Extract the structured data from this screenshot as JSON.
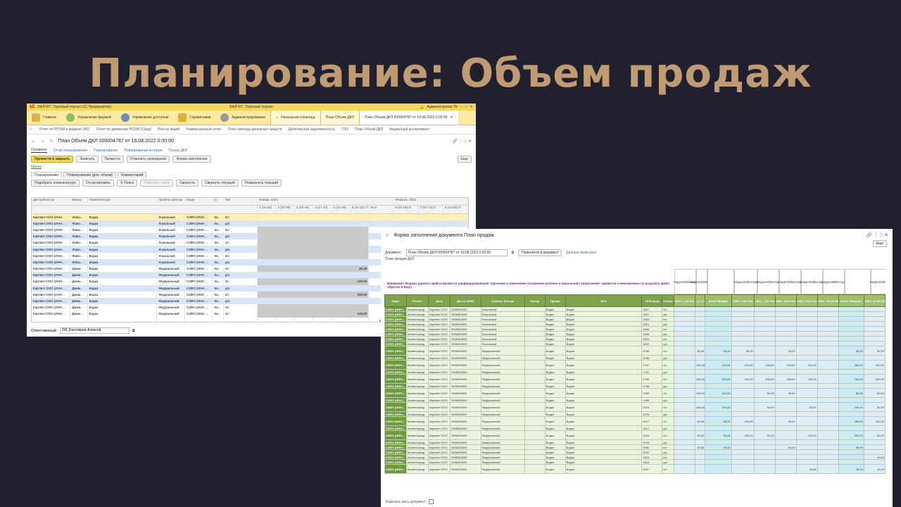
{
  "slide_title": "Планирование: Объем продаж",
  "win1": {
    "app_title": "БАЛЧУГ: Торговый портал",
    "app_subtitle": "БАЛЧУГ: Торговый портал (1С:Предприятие)",
    "user": "Администратор ТК",
    "sections": [
      "Главное",
      "Управление фирмой",
      "Управление доступом",
      "Справочники",
      "Администрирование"
    ],
    "open_tabs": [
      "Начальная страница",
      "План Объем ДКЛ",
      "План Объем ДКЛ 000004787 от 19.08.2022 0:00:00"
    ],
    "links": [
      "Отчет по POSM в разрезе SKU",
      "Отчет по движению POSM (Свод)",
      "Реестр акций",
      "Универсальный отчет",
      "План прихода денежных средств",
      "Дебиторская задолженность",
      "ТЗО",
      "План Объем ДКЛ",
      "Акционный ассортимент"
    ],
    "doc_title": "План Объем ДКЛ 000004787 от 19.08.2022 0:00:00",
    "doc_tabs": [
      "Основное",
      "Отчет планирования",
      "Планирование",
      "Планирование история",
      "Планы ДКЛ"
    ],
    "commands": {
      "post_close": "Провести и закрыть",
      "save": "Записать",
      "post": "Провести",
      "cancel_post": "Отменить проведение",
      "fill_form": "Форма заполнения",
      "more": "Еще"
    },
    "link_green": "Шапка",
    "subtabs": [
      "Планирование",
      "Планирование (доп. объем)",
      "Комментарий"
    ],
    "table_cmds": [
      "Подобрать номенклатуру",
      "Отсортировать",
      "Поиск",
      "Отменить поиск",
      "Свернуть",
      "Свернуть текущий",
      "Развернуть текущий"
    ],
    "columns": [
      "Дистрибьютор",
      "Бренд",
      "Номенклатура",
      "Уровень бренда",
      "Округ",
      "О.",
      "Тип"
    ],
    "period1": "Январь 2022",
    "period2": "Февраль 2022",
    "weeks1": [
      "1 (01-02)",
      "2 (03-09)",
      "3 (10-16)",
      "4 (17-23)",
      "5 (24-30)",
      "6 (31-31) П",
      "Итог"
    ],
    "weeks2": [
      "6 (01-06) П",
      "7 (07-13) П",
      "8 (14-20) П"
    ],
    "rows": [
      {
        "d": "Картвел ООО (ИНН...",
        "b": "Жаво...",
        "n": "Водка",
        "l": "Локальный",
        "o": "СЗФО (ИНН ...",
        "o2": "Ка...",
        "t": "п/с",
        "v1": "",
        "v2": "",
        "style": "y",
        "grey": false
      },
      {
        "d": "Картвел ООО (ИНН...",
        "b": "Жаво...",
        "n": "Водка",
        "l": "Локальный",
        "o": "СЗФО (ИНН ...",
        "o2": "Ка...",
        "t": "д/о",
        "v1": "",
        "v2": "",
        "style": "b",
        "grey": false
      },
      {
        "d": "Картвел ООО (ИНН...",
        "b": "Жаво...",
        "n": "Водка",
        "l": "Локальный",
        "o": "СЗФО (ИНН ...",
        "o2": "Ка...",
        "t": "п/с",
        "v1": "",
        "v2": "",
        "style": "",
        "grey": true
      },
      {
        "d": "Картвел ООО (ИНН...",
        "b": "Жаво...",
        "n": "Водка",
        "l": "Локальный",
        "o": "СЗФО (ИНН ...",
        "o2": "Ка...",
        "t": "д/о",
        "v1": "",
        "v2": "",
        "style": "b",
        "grey": true
      },
      {
        "d": "Картвел ООО (ИНН...",
        "b": "Жаво...",
        "n": "Водка",
        "l": "Локальный",
        "o": "СЗФО (ИНН ...",
        "o2": "Ка...",
        "t": "п/с",
        "v1": "",
        "v2": "",
        "style": "",
        "grey": true
      },
      {
        "d": "Картвел ООО (ИНН...",
        "b": "Жаво...",
        "n": "Водка",
        "l": "Локальный",
        "o": "СЗФО (ИНН ...",
        "o2": "Ка...",
        "t": "д/о",
        "v1": "",
        "v2": "",
        "style": "b",
        "grey": true
      },
      {
        "d": "Картвел ООО (ИНН...",
        "b": "Жаво...",
        "n": "Водка",
        "l": "Локальный",
        "o": "СЗФО (ИНН ...",
        "o2": "Ка...",
        "t": "п/с",
        "v1": "",
        "v2": "",
        "style": "",
        "grey": true
      },
      {
        "d": "Картвел ООО (ИНН...",
        "b": "Жаво...",
        "n": "Водка",
        "l": "Локальный",
        "o": "СЗФО (ИНН ...",
        "o2": "Ка...",
        "t": "д/о",
        "v1": "",
        "v2": "",
        "style": "b",
        "grey": false
      },
      {
        "d": "Картвел ООО (ИНН...",
        "b": "Джем...",
        "n": "Водка",
        "l": "Федеральный",
        "o": "СЗФО (ИНН ...",
        "o2": "Ка...",
        "t": "п/с",
        "v1": "30,00",
        "v2": "30,00",
        "style": "",
        "grey": true
      },
      {
        "d": "Картвел ООО (ИНН...",
        "b": "Джем...",
        "n": "Водка",
        "l": "Федеральный",
        "o": "СЗФО (ИНН ...",
        "o2": "Ка...",
        "t": "д/о",
        "v1": "",
        "v2": "",
        "style": "b",
        "grey": false
      },
      {
        "d": "Картвел ООО (ИНН...",
        "b": "Джем...",
        "n": "Водка",
        "l": "Федеральный",
        "o": "СЗФО (ИНН ...",
        "o2": "Ка...",
        "t": "п/с",
        "v1": "100,00",
        "v2": "100,00",
        "style": "",
        "grey": true
      },
      {
        "d": "Картвел ООО (ИНН...",
        "b": "Джем...",
        "n": "Водка",
        "l": "Федеральный",
        "o": "СЗФО (ИНН ...",
        "o2": "Ка...",
        "t": "д/о",
        "v1": "",
        "v2": "",
        "style": "b",
        "grey": false
      },
      {
        "d": "Картвел ООО (ИНН...",
        "b": "Джем...",
        "n": "Водка",
        "l": "Федеральный",
        "o": "СЗФО (ИНН ...",
        "o2": "Ка...",
        "t": "п/с",
        "v1": "300,00",
        "v2": "300,00",
        "style": "",
        "grey": true
      },
      {
        "d": "Картвел ООО (ИНН...",
        "b": "Джем...",
        "n": "Водка",
        "l": "Федеральный",
        "o": "СЗФО (ИНН ...",
        "o2": "Ка...",
        "t": "д/о",
        "v1": "",
        "v2": "",
        "style": "b",
        "grey": false
      },
      {
        "d": "Картвел ООО (ИНН...",
        "b": "Джем...",
        "n": "Водка",
        "l": "Федеральный",
        "o": "СЗФО (ИНН ...",
        "o2": "Ка...",
        "t": "п/с",
        "v1": "",
        "v2": "",
        "style": "",
        "grey": true
      },
      {
        "d": "Картвел ООО (ИНН...",
        "b": "Джем...",
        "n": "Водка",
        "l": "Федеральный",
        "o": "СЗФО (ИНН ...",
        "o2": "Ка...",
        "t": "п/с",
        "v1": "100,00",
        "v2": "100,00",
        "style": "",
        "grey": true
      }
    ],
    "totals": [
      "2 214,00",
      "2 214,00"
    ],
    "responsible_label": "Ответственный:",
    "responsible_value": "ТМ_Бахтияров Алексей"
  },
  "win2": {
    "title": "Форма заполнения документа План продаж",
    "more": "Еще",
    "doc_label": "Документ:",
    "doc_value": "План Объем ДКЛ 000004787 от 19.08.2022 0:00:00",
    "transfer_btn": "Перенести в документ",
    "saved_msg": "Данные записаны!",
    "plan_label": "План продаж ДКЛ",
    "warning": "Внимание! Формат данного файла является унифицированным. Удаление и изменение положения колонок и начальной строки может привести к невозможности загрузить файл обратно в базу!",
    "weeks": [
      "Неделя1Месяц1",
      "Неделя1Месяц1",
      "",
      "Неделя2Месяц2",
      "Неделя2Месяц2",
      "Неделя3Месяц2",
      "Неделя4Месяц2",
      "Неделя5Месяц2",
      "",
      "Неделя1Месяц3"
    ],
    "headers": [
      "Округ",
      "Регион",
      "Диср",
      "Дистр (ИНН)",
      "Уровень бренда",
      "Бренд",
      "Группа",
      "SKU",
      "СКЮ (код)",
      "Статус",
      "2022_1 (01-02)",
      "_2_0 -02)",
      "Итого Январь",
      "2022_6 (01-06)",
      "2022_7 (07-13)",
      "2022_8 (14-20)",
      "2022_9 (21-27)",
      "2022_10 (28-28)",
      "Итого Февраль",
      "2022_10 (01-06)"
    ],
    "rows": [
      {
        "l": "Локальный",
        "code": "1827",
        "st": "п/с",
        "v": [
          "",
          "",
          "",
          "",
          "",
          "",
          "",
          "",
          "",
          ""
        ]
      },
      {
        "l": "Локальный",
        "code": "1827",
        "st": "д/о",
        "v": [
          "",
          "",
          "",
          "",
          "",
          "",
          "",
          "",
          "",
          ""
        ]
      },
      {
        "l": "Локальный",
        "code": "1822",
        "st": "п/с",
        "v": [
          "",
          "",
          "",
          "",
          "",
          "",
          "",
          "",
          "",
          ""
        ]
      },
      {
        "l": "Локальный",
        "code": "1822",
        "st": "д/о",
        "v": [
          "",
          "",
          "",
          "",
          "",
          "",
          "",
          "",
          "",
          ""
        ]
      },
      {
        "l": "Локальный",
        "code": "1826",
        "st": "п/с",
        "v": [
          "",
          "",
          "",
          "",
          "",
          "",
          "",
          "",
          "",
          ""
        ]
      },
      {
        "l": "Локальный",
        "code": "1826",
        "st": "д/о",
        "v": [
          "",
          "",
          "",
          "",
          "",
          "",
          "",
          "",
          "",
          ""
        ]
      },
      {
        "l": "Локальный",
        "code": "1823",
        "st": "п/с",
        "v": [
          "",
          "",
          "",
          "",
          "",
          "",
          "",
          "",
          "",
          ""
        ]
      },
      {
        "l": "Локальный",
        "code": "1823",
        "st": "д/о",
        "v": [
          "",
          "",
          "",
          "",
          "",
          "",
          "",
          "",
          "",
          ""
        ]
      },
      {
        "l": "Федеральный",
        "code": "2098",
        "st": "п/с",
        "v": [
          "",
          "30,00",
          "30,00",
          "30,00",
          "",
          "20,00",
          "",
          "",
          "50,00",
          "30,00"
        ],
        "tall": true
      },
      {
        "l": "Федеральный",
        "code": "2098",
        "st": "д/о",
        "v": [
          "",
          "",
          "",
          "",
          "",
          "",
          "",
          "",
          "",
          ""
        ]
      },
      {
        "l": "Федеральный",
        "code": "1797",
        "st": "п/с",
        "v": [
          "",
          "100,00",
          "100,00",
          "100,00",
          "100,00",
          "100,00",
          "100,00",
          "",
          "400,00",
          "150,00"
        ],
        "tall": true
      },
      {
        "l": "Федеральный",
        "code": "1797",
        "st": "д/о",
        "v": [
          "",
          "",
          "",
          "",
          "",
          "",
          "",
          "",
          "",
          ""
        ]
      },
      {
        "l": "Федеральный",
        "code": "1796",
        "st": "п/с",
        "v": [
          "",
          "300,00",
          "300,00",
          "100,00",
          "200,00",
          "250,00",
          "150,00",
          "",
          "700,00",
          "200,00"
        ],
        "tall": true
      },
      {
        "l": "Федеральный",
        "code": "1796",
        "st": "д/о",
        "v": [
          "",
          "",
          "",
          "",
          "",
          "",
          "",
          "",
          "",
          ""
        ]
      },
      {
        "l": "Федеральный",
        "code": "1999",
        "st": "п/с",
        "v": [
          "",
          "100,00",
          "100,00",
          "",
          "50,00",
          "30,00",
          "",
          "",
          "80,00",
          "50,00"
        ],
        "tall": true
      },
      {
        "l": "Федеральный",
        "code": "1999",
        "st": "д/о",
        "v": [
          "",
          "",
          "",
          "",
          "",
          "",
          "",
          "",
          "",
          ""
        ]
      },
      {
        "l": "Федеральный",
        "code": "2078",
        "st": "п/с",
        "v": [
          "",
          "100,00",
          "100,00",
          "",
          "50,00",
          "",
          "50,00",
          "",
          "100,00",
          "50,00"
        ],
        "tall": true
      },
      {
        "l": "Федеральный",
        "code": "2078",
        "st": "д/о",
        "v": [
          "",
          "",
          "",
          "",
          "",
          "",
          "",
          "",
          "",
          ""
        ]
      },
      {
        "l": "Федеральный",
        "code": "2017",
        "st": "п/с",
        "v": [
          "",
          "80,00",
          "80,00",
          "100,00",
          "",
          "50,00",
          "",
          "",
          "150,00",
          "100,00"
        ],
        "tall": true
      },
      {
        "l": "Федеральный",
        "code": "2017",
        "st": "д/о",
        "v": [
          "",
          "",
          "",
          "",
          "",
          "",
          "",
          "",
          "",
          ""
        ]
      },
      {
        "l": "Федеральный",
        "code": "2016",
        "st": "п/с",
        "v": [
          "",
          "50,00",
          "50,00",
          "150,00",
          "50,00",
          "",
          "100,00",
          "",
          "300,00",
          "50,00"
        ],
        "tall": true
      },
      {
        "l": "Федеральный",
        "code": "2016",
        "st": "д/о",
        "v": [
          "",
          "",
          "",
          "",
          "",
          "",
          "",
          "",
          "",
          ""
        ]
      },
      {
        "l": "Федеральный",
        "code": "2002",
        "st": "п/с",
        "v": [
          "",
          "20,00",
          "20,00",
          "",
          "",
          "50,00",
          "",
          "",
          "50,00",
          ""
        ]
      },
      {
        "l": "Федеральный",
        "code": "2002",
        "st": "д/о",
        "v": [
          "",
          "",
          "",
          "",
          "",
          "",
          "",
          "",
          "",
          ""
        ]
      },
      {
        "l": "Федеральный",
        "code": "1816",
        "st": "п/с",
        "v": [
          "",
          "",
          "",
          "",
          "",
          "",
          "",
          "",
          "",
          "10,00"
        ]
      },
      {
        "l": "Федеральный",
        "code": "1816",
        "st": "д/о",
        "v": [
          "",
          "",
          "",
          "",
          "",
          "",
          "",
          "",
          "",
          ""
        ]
      },
      {
        "l": "Федеральный",
        "code": "2057",
        "st": "п/с",
        "v": [
          "",
          "",
          "",
          "",
          "",
          "",
          "15,00",
          "",
          "15,00",
          "10,00"
        ],
        "tall": true
      }
    ],
    "okrug": "СЗФО (ИНН )",
    "region": "Калининград",
    "distr": "Картвел ООО",
    "inn": "3906363993",
    "group": "Водка",
    "sku": "Водка",
    "footer_label": "Заменить весь документ:"
  },
  "colors": {
    "background": "#21202e",
    "title": "#c09a73",
    "section_bar": "#fbeaa0",
    "header_green": "#7fa34f"
  }
}
